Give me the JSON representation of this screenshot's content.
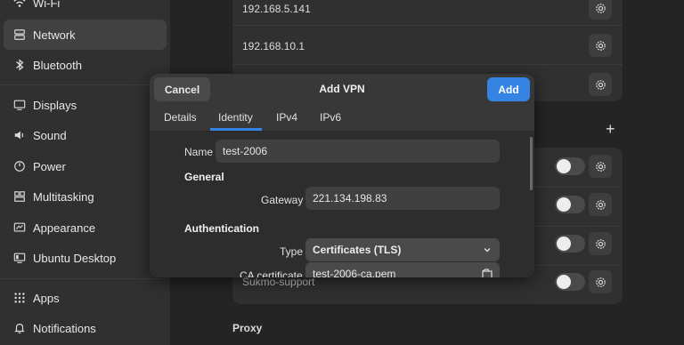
{
  "sidebar": {
    "items": [
      {
        "label": "Wi-Fi",
        "icon": "wifi-icon"
      },
      {
        "label": "Network",
        "icon": "network-icon",
        "active": true
      },
      {
        "label": "Bluetooth",
        "icon": "bluetooth-icon"
      },
      {
        "label": "Displays",
        "icon": "display-icon"
      },
      {
        "label": "Sound",
        "icon": "sound-icon"
      },
      {
        "label": "Power",
        "icon": "power-icon"
      },
      {
        "label": "Multitasking",
        "icon": "multitasking-icon"
      },
      {
        "label": "Appearance",
        "icon": "appearance-icon"
      },
      {
        "label": "Ubuntu Desktop",
        "icon": "ubuntu-desktop-icon"
      },
      {
        "label": "Apps",
        "icon": "apps-icon"
      },
      {
        "label": "Notifications",
        "icon": "notifications-icon"
      }
    ]
  },
  "main": {
    "top_rows": [
      "192.168.5.141",
      "192.168.10.1"
    ],
    "vpn_visible_row": "Sukmo-support",
    "proxy_label": "Proxy"
  },
  "dialog": {
    "cancel_label": "Cancel",
    "title": "Add VPN",
    "add_label": "Add",
    "tabs": [
      "Details",
      "Identity",
      "IPv4",
      "IPv6"
    ],
    "active_tab": "Identity",
    "name_label": "Name",
    "name_value": "test-2006",
    "general_heading": "General",
    "gateway_label": "Gateway",
    "gateway_value": "221.134.198.83",
    "auth_heading": "Authentication",
    "type_label": "Type",
    "type_value": "Certificates (TLS)",
    "ca_cert_label": "CA certificate",
    "ca_cert_value": "test-2006-ca.pem"
  },
  "colors": {
    "accent": "#3584e4",
    "sidebar_bg": "#303030",
    "window_bg": "#242424"
  }
}
